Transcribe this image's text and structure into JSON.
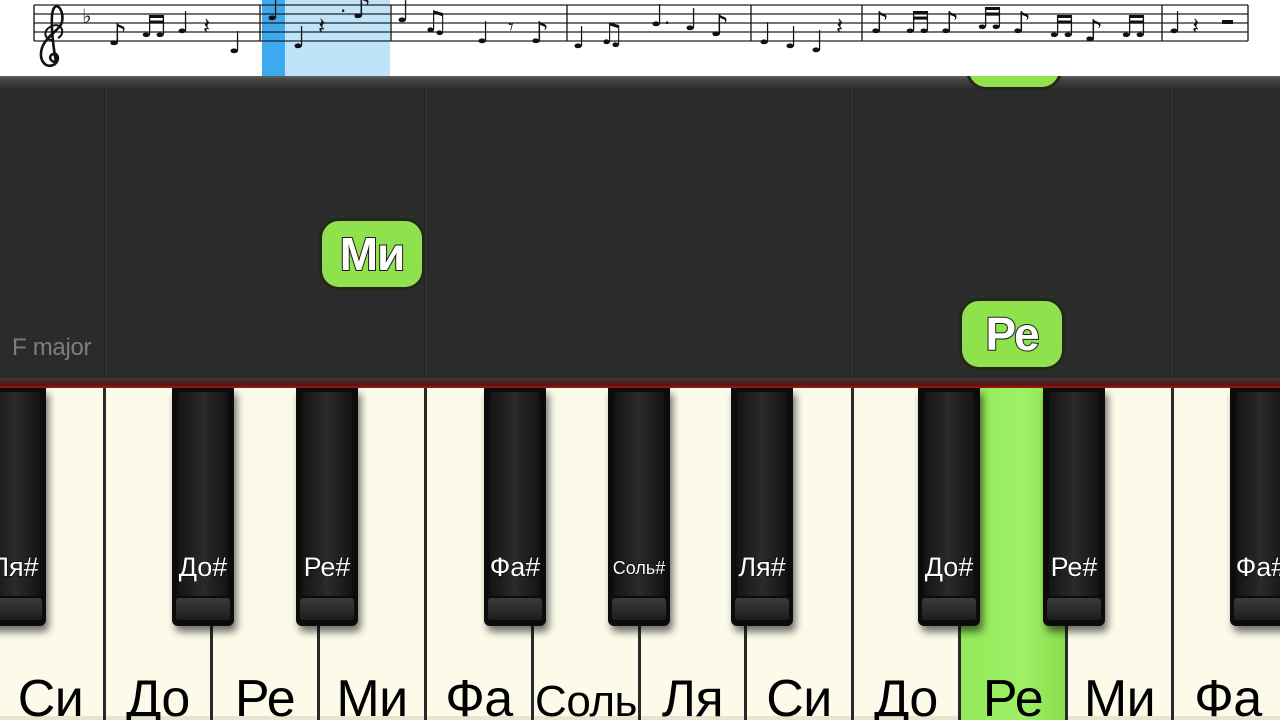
{
  "score": {
    "clef": "treble-clef-icon",
    "key_signature": "flat-icon",
    "highlight_color": "#bfe3f8",
    "cursor_color": "#3daaf0"
  },
  "keyboard_area": {
    "key_signature_label": "F major"
  },
  "falling_notes": [
    {
      "label": "Ми"
    },
    {
      "label": "Ре"
    },
    {
      "label": ""
    }
  ],
  "keys": {
    "white": [
      "Си",
      "До",
      "Ре",
      "Ми",
      "Фа",
      "Соль",
      "Ля",
      "Си",
      "До",
      "Ре",
      "Ми",
      "Фа"
    ],
    "black": [
      "Ля#",
      "До#",
      "Ре#",
      "Фа#",
      "Соль#",
      "Ля#",
      "До#",
      "Ре#",
      "Фа#"
    ],
    "active_white_index": 9,
    "active_color": "#93e95a"
  },
  "colors": {
    "note_green": "#8ee24c",
    "rail_red": "#b01818",
    "white_key": "#fcfbea",
    "background": "#2b2b2b"
  }
}
